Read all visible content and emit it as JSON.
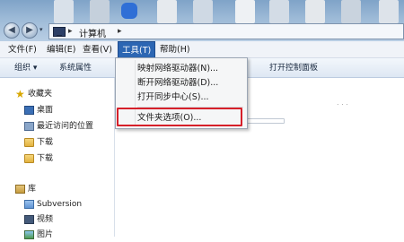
{
  "address": {
    "location": "计算机",
    "arrow": "▸"
  },
  "nav_buttons": {
    "back": "◀",
    "forward": "▶",
    "recent": "▾"
  },
  "menubar": {
    "items": [
      "文件(F)",
      "编辑(E)",
      "查看(V)",
      "工具(T)",
      "帮助(H)"
    ]
  },
  "toolbar": {
    "organize": "组织 ▾",
    "system_properties": "系统属性",
    "control_panel": "打开控制面板"
  },
  "tools_menu": {
    "items": [
      "映射网络驱动器(N)...",
      "断开网络驱动器(D)...",
      "打开同步中心(S)...",
      "文件夹选项(O)..."
    ],
    "highlighted_item": "文件夹选项(O)...",
    "highlight_color": "#d6202a"
  },
  "navigation": {
    "favorites_header": "收藏夹",
    "favorites": [
      "桌面",
      "最近访问的位置",
      "下载",
      "下载"
    ],
    "libraries_header": "库",
    "libraries": [
      "Subversion",
      "视频",
      "图片"
    ]
  },
  "colors": {
    "menu_active_bg": "#2c66b3",
    "title_gradient_top": "#7fa3c8"
  }
}
